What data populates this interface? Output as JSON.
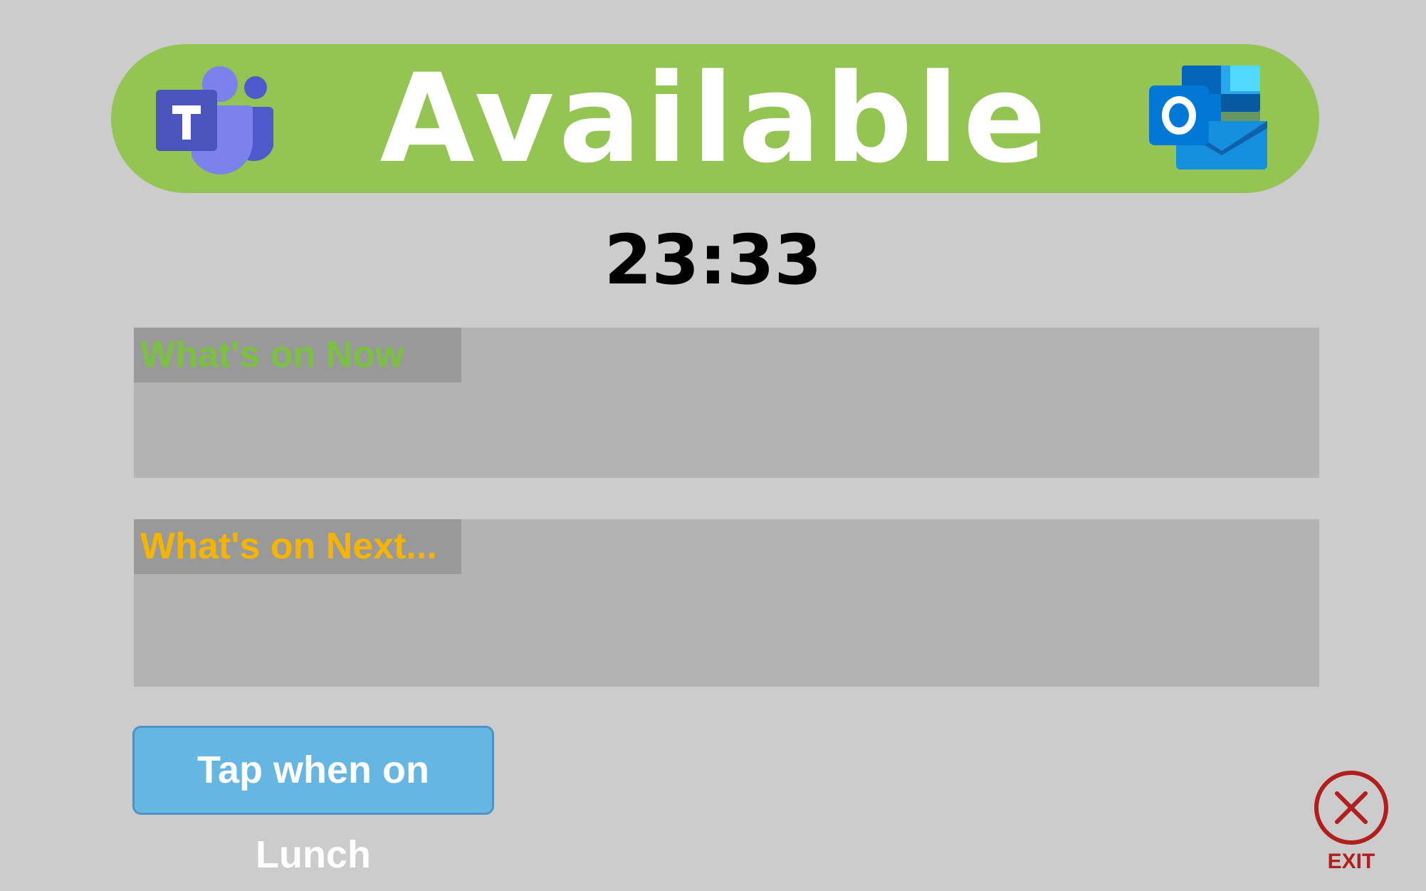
{
  "status": {
    "text": "Available",
    "color": "#93c454",
    "left_icon": "teams-icon",
    "right_icon": "outlook-icon"
  },
  "clock": {
    "time": "23:33"
  },
  "now_panel": {
    "label": "What's on Now",
    "label_color": "#7ac142"
  },
  "next_panel": {
    "label": "What's on Next...",
    "label_color": "#f4b400"
  },
  "lunch_button": {
    "label": "Tap when on Lunch",
    "color": "#66b6e3"
  },
  "exit_button": {
    "label": "EXIT",
    "icon": "close-icon",
    "color": "#b01e1e"
  }
}
